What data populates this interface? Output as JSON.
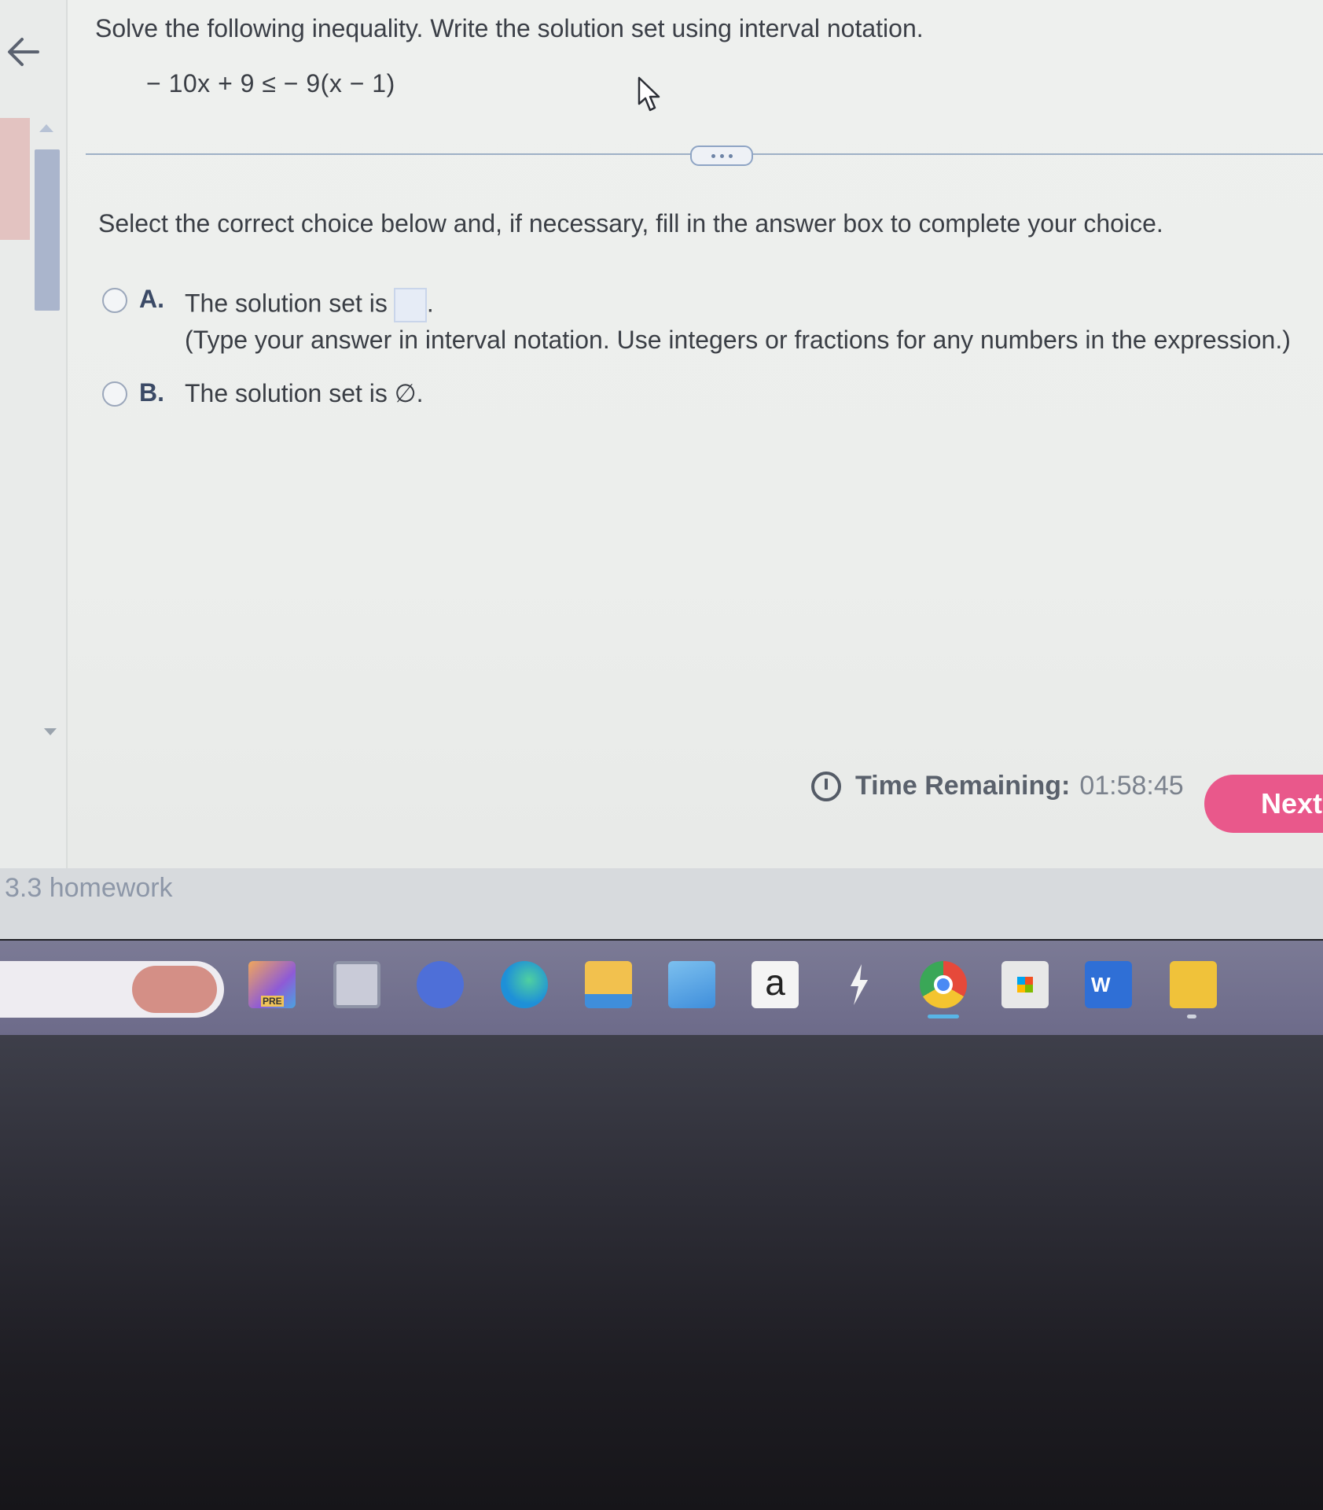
{
  "question": {
    "prompt": "Solve the following inequality. Write the solution set using interval notation.",
    "equation": "− 10x + 9 ≤  − 9(x − 1)"
  },
  "instruction": "Select the correct choice below and, if necessary, fill in the answer box to complete your choice.",
  "choices": [
    {
      "letter": "A.",
      "text": "The solution set is",
      "trailing": ".",
      "hint": "(Type your answer in interval notation. Use integers or fractions for any numbers in the expression.)",
      "answer_value": ""
    },
    {
      "letter": "B.",
      "text": "The solution set is ∅."
    }
  ],
  "timer": {
    "label": "Time Remaining:",
    "value": "01:58:45"
  },
  "next_button": "Next",
  "footer": {
    "assignment_title": "3.3 homework"
  },
  "taskbar": {
    "icons": [
      {
        "name": "copilot-icon",
        "badge": "PRE",
        "color": "#f0a65c"
      },
      {
        "name": "task-view-icon",
        "color": "#9aa0b3"
      },
      {
        "name": "video-call-icon",
        "color": "#4e6fd8"
      },
      {
        "name": "edge-browser-icon",
        "color": "#1e90d8"
      },
      {
        "name": "file-explorer-icon",
        "color": "#f2c14e"
      },
      {
        "name": "mail-icon",
        "color": "#3f8edb"
      },
      {
        "name": "amazon-icon",
        "glyph": "a",
        "color": "#f4f4f4"
      },
      {
        "name": "zapper-icon",
        "color": "#f4f4f4"
      },
      {
        "name": "chrome-icon",
        "color": "#e6493a"
      },
      {
        "name": "microsoft-store-icon",
        "color": "#e8e8e8"
      },
      {
        "name": "word-icon",
        "glyph": "W",
        "color": "#2f6fd6"
      },
      {
        "name": "sticky-notes-icon",
        "color": "#f0c23a"
      }
    ]
  }
}
